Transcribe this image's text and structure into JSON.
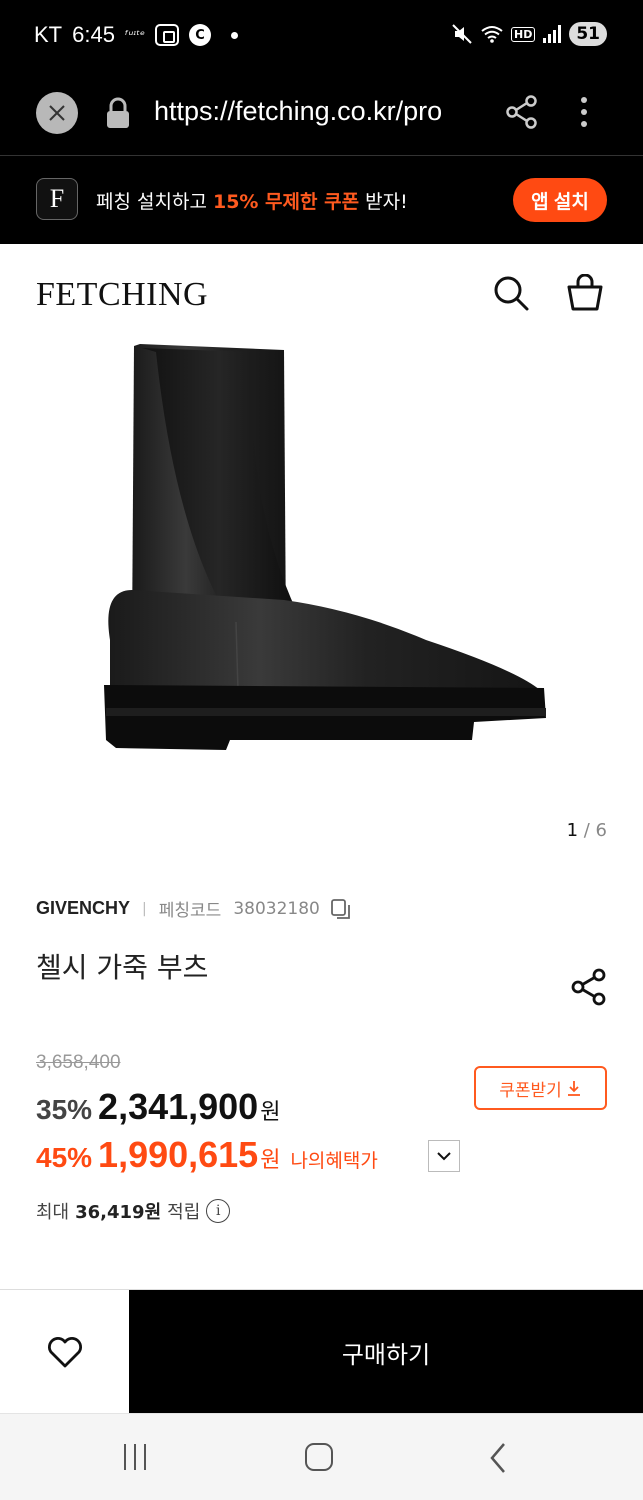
{
  "status_bar": {
    "carrier": "KT",
    "time": "6:45",
    "small_label": "ᶠᵘᶦᵗᵉ",
    "c_badge": "C",
    "hd_label": "HD",
    "battery": "51"
  },
  "browser": {
    "url": "https://fetching.co.kr/pro"
  },
  "app_banner": {
    "logo_letter": "F",
    "text_prefix": "페칭 설치하고 ",
    "text_highlight": "15% 무제한 쿠폰",
    "text_suffix": " 받자!",
    "button_label": "앱 설치"
  },
  "header": {
    "logo": "FETCHING"
  },
  "gallery": {
    "current": "1",
    "separator": " / ",
    "total": "6"
  },
  "product": {
    "brand": "GIVENCHY",
    "separator": "|",
    "code_label": "페칭코드",
    "code": "38032180",
    "name": "첼시 가죽 부츠",
    "original_price": "3,658,400",
    "discount1": "35%",
    "price1": "2,341,900",
    "currency": "원",
    "coupon_button": "쿠폰받기",
    "discount2": "45%",
    "price2": "1,990,615",
    "benefit_label": "나의혜택가",
    "points_prefix": "최대",
    "points_value": "36,419원",
    "points_suffix": "적립"
  },
  "bottom_bar": {
    "buy_label": "구매하기"
  },
  "colors": {
    "accent": "#ff4a12",
    "black": "#000000"
  }
}
